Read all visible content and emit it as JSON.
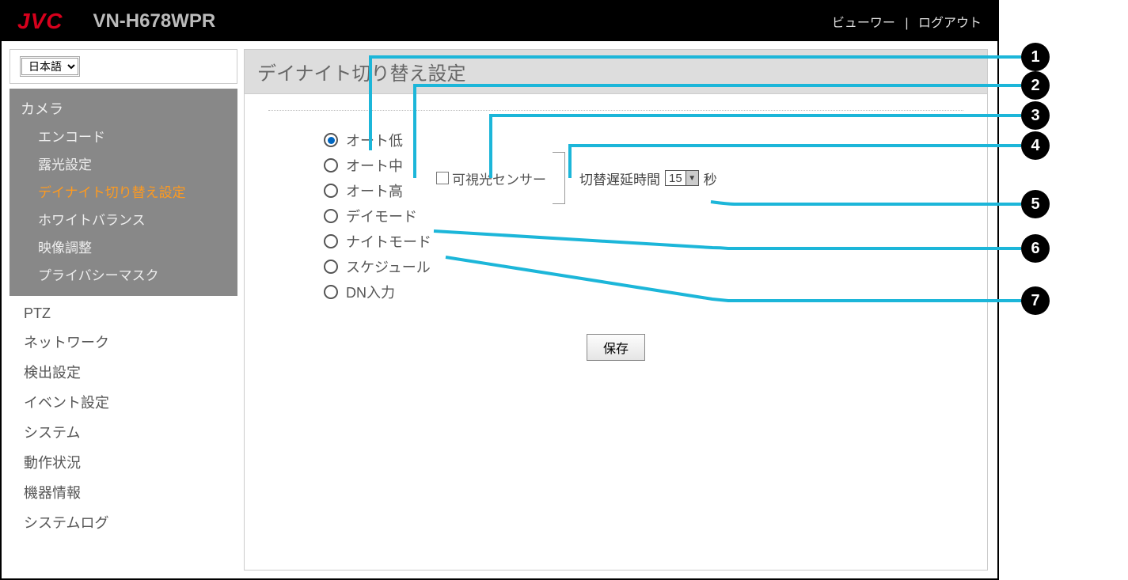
{
  "header": {
    "logo": "JVC",
    "model": "VN-H678WPR",
    "viewer": "ビューワー",
    "separator": "|",
    "logout": "ログアウト"
  },
  "language": {
    "selected": "日本語"
  },
  "sidebar": {
    "camera_head": "カメラ",
    "camera_items": [
      {
        "label": "エンコード",
        "active": false
      },
      {
        "label": "露光設定",
        "active": false
      },
      {
        "label": "デイナイト切り替え設定",
        "active": true
      },
      {
        "label": "ホワイトバランス",
        "active": false
      },
      {
        "label": "映像調整",
        "active": false
      },
      {
        "label": "プライバシーマスク",
        "active": false
      }
    ],
    "plain_items": [
      "PTZ",
      "ネットワーク",
      "検出設定",
      "イベント設定",
      "システム",
      "動作状況",
      "機器情報",
      "システムログ"
    ]
  },
  "main": {
    "title": "デイナイト切り替え設定",
    "radios": [
      {
        "label": "オート低",
        "checked": true
      },
      {
        "label": "オート中",
        "checked": false
      },
      {
        "label": "オート高",
        "checked": false
      },
      {
        "label": "デイモード",
        "checked": false
      },
      {
        "label": "ナイトモード",
        "checked": false
      },
      {
        "label": "スケジュール",
        "checked": false
      },
      {
        "label": "DN入力",
        "checked": false
      }
    ],
    "sensor_label": "可視光センサー",
    "delay_label": "切替遅延時間",
    "delay_value": "15",
    "delay_unit": "秒",
    "save": "保存"
  },
  "callouts": [
    "1",
    "2",
    "3",
    "4",
    "5",
    "6",
    "7"
  ],
  "colors": {
    "accent_line": "#1cb6d9",
    "logo": "#d6001c",
    "active_nav": "#ff9a1e"
  }
}
